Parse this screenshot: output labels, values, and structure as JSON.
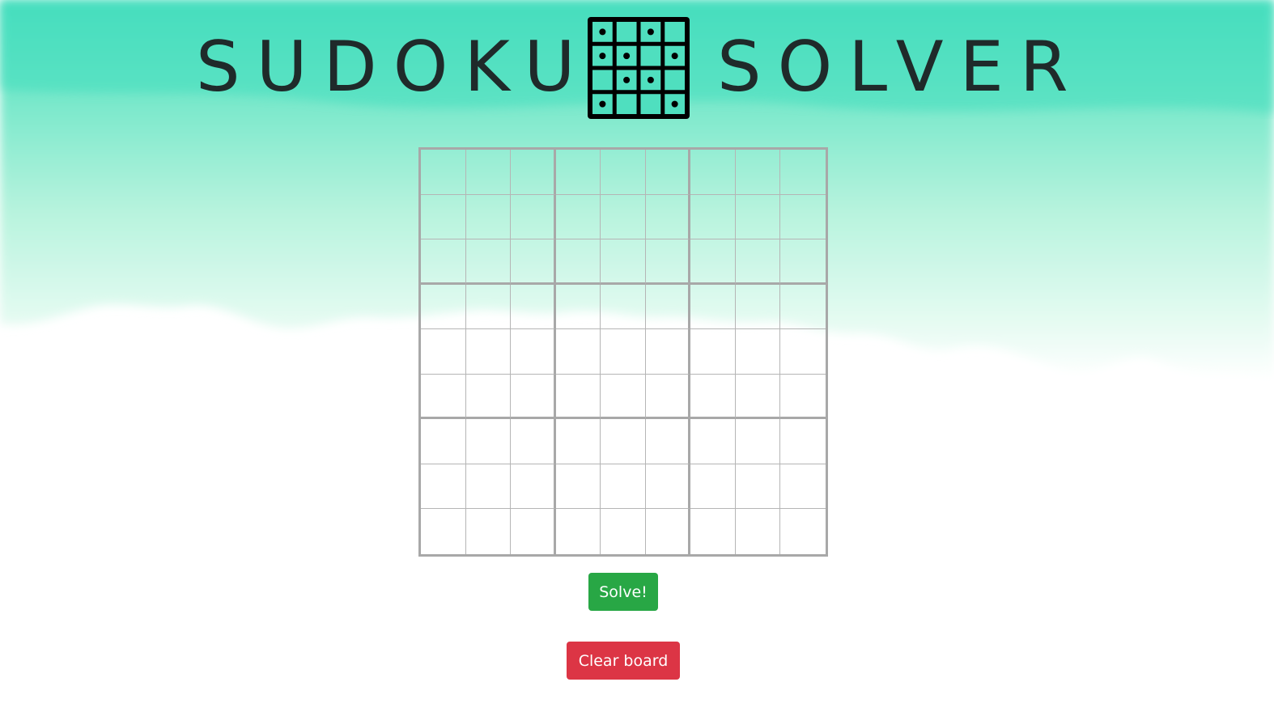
{
  "header": {
    "title_left": "SUDOKU",
    "title_right": "SOLVER",
    "logo_icon": "sudoku-grid-icon"
  },
  "board": {
    "rows": 9,
    "cols": 9,
    "cells": [
      [
        "",
        "",
        "",
        "",
        "",
        "",
        "",
        "",
        ""
      ],
      [
        "",
        "",
        "",
        "",
        "",
        "",
        "",
        "",
        ""
      ],
      [
        "",
        "",
        "",
        "",
        "",
        "",
        "",
        "",
        ""
      ],
      [
        "",
        "",
        "",
        "",
        "",
        "",
        "",
        "",
        ""
      ],
      [
        "",
        "",
        "",
        "",
        "",
        "",
        "",
        "",
        ""
      ],
      [
        "",
        "",
        "",
        "",
        "",
        "",
        "",
        "",
        ""
      ],
      [
        "",
        "",
        "",
        "",
        "",
        "",
        "",
        "",
        ""
      ],
      [
        "",
        "",
        "",
        "",
        "",
        "",
        "",
        "",
        ""
      ],
      [
        "",
        "",
        "",
        "",
        "",
        "",
        "",
        "",
        ""
      ]
    ]
  },
  "actions": {
    "solve_label": "Solve!",
    "clear_label": "Clear board"
  },
  "colors": {
    "accent_teal": "#4fdfbf",
    "solve_button": "#28a745",
    "clear_button": "#dc3545",
    "title_text": "#1f2a2a",
    "grid_line": "#b5b5b5"
  }
}
